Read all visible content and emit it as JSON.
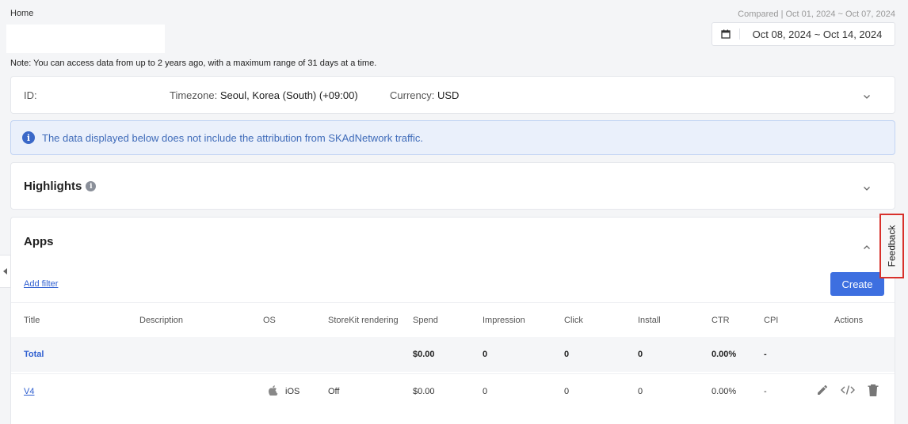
{
  "breadcrumb": "Home",
  "compared_text": "Compared | Oct 01, 2024 ~ Oct 07, 2024",
  "date_range": "Oct 08, 2024 ~ Oct 14, 2024",
  "note": "Note: You can access data from up to 2 years ago, with a maximum range of 31 days at a time.",
  "info": {
    "id_label": "ID:",
    "id_value": "",
    "timezone_label": "Timezone:",
    "timezone_value": "Seoul, Korea (South) (+09:00)",
    "currency_label": "Currency:",
    "currency_value": "USD"
  },
  "banner": "The data displayed below does not include the attribution from SKAdNetwork traffic.",
  "highlights": {
    "title": "Highlights"
  },
  "apps": {
    "title": "Apps",
    "add_filter": "Add filter",
    "create_label": "Create",
    "columns": [
      "Title",
      "Description",
      "OS",
      "StoreKit rendering",
      "Spend",
      "Impression",
      "Click",
      "Install",
      "CTR",
      "CPI",
      "Actions"
    ],
    "total": {
      "title": "Total",
      "spend": "$0.00",
      "impression": "0",
      "click": "0",
      "install": "0",
      "ctr": "0.00%",
      "cpi": "-"
    },
    "rows": [
      {
        "title": "V4",
        "description": "",
        "os": "iOS",
        "storekit": "Off",
        "spend": "$0.00",
        "impression": "0",
        "click": "0",
        "install": "0",
        "ctr": "0.00%",
        "cpi": "-"
      }
    ]
  },
  "feedback_label": "Feedback",
  "colors": {
    "accent": "#3d6fe0",
    "link": "#2f5fd0",
    "banner_bg": "#eaf0fb",
    "highlight_border": "#d8312b"
  }
}
